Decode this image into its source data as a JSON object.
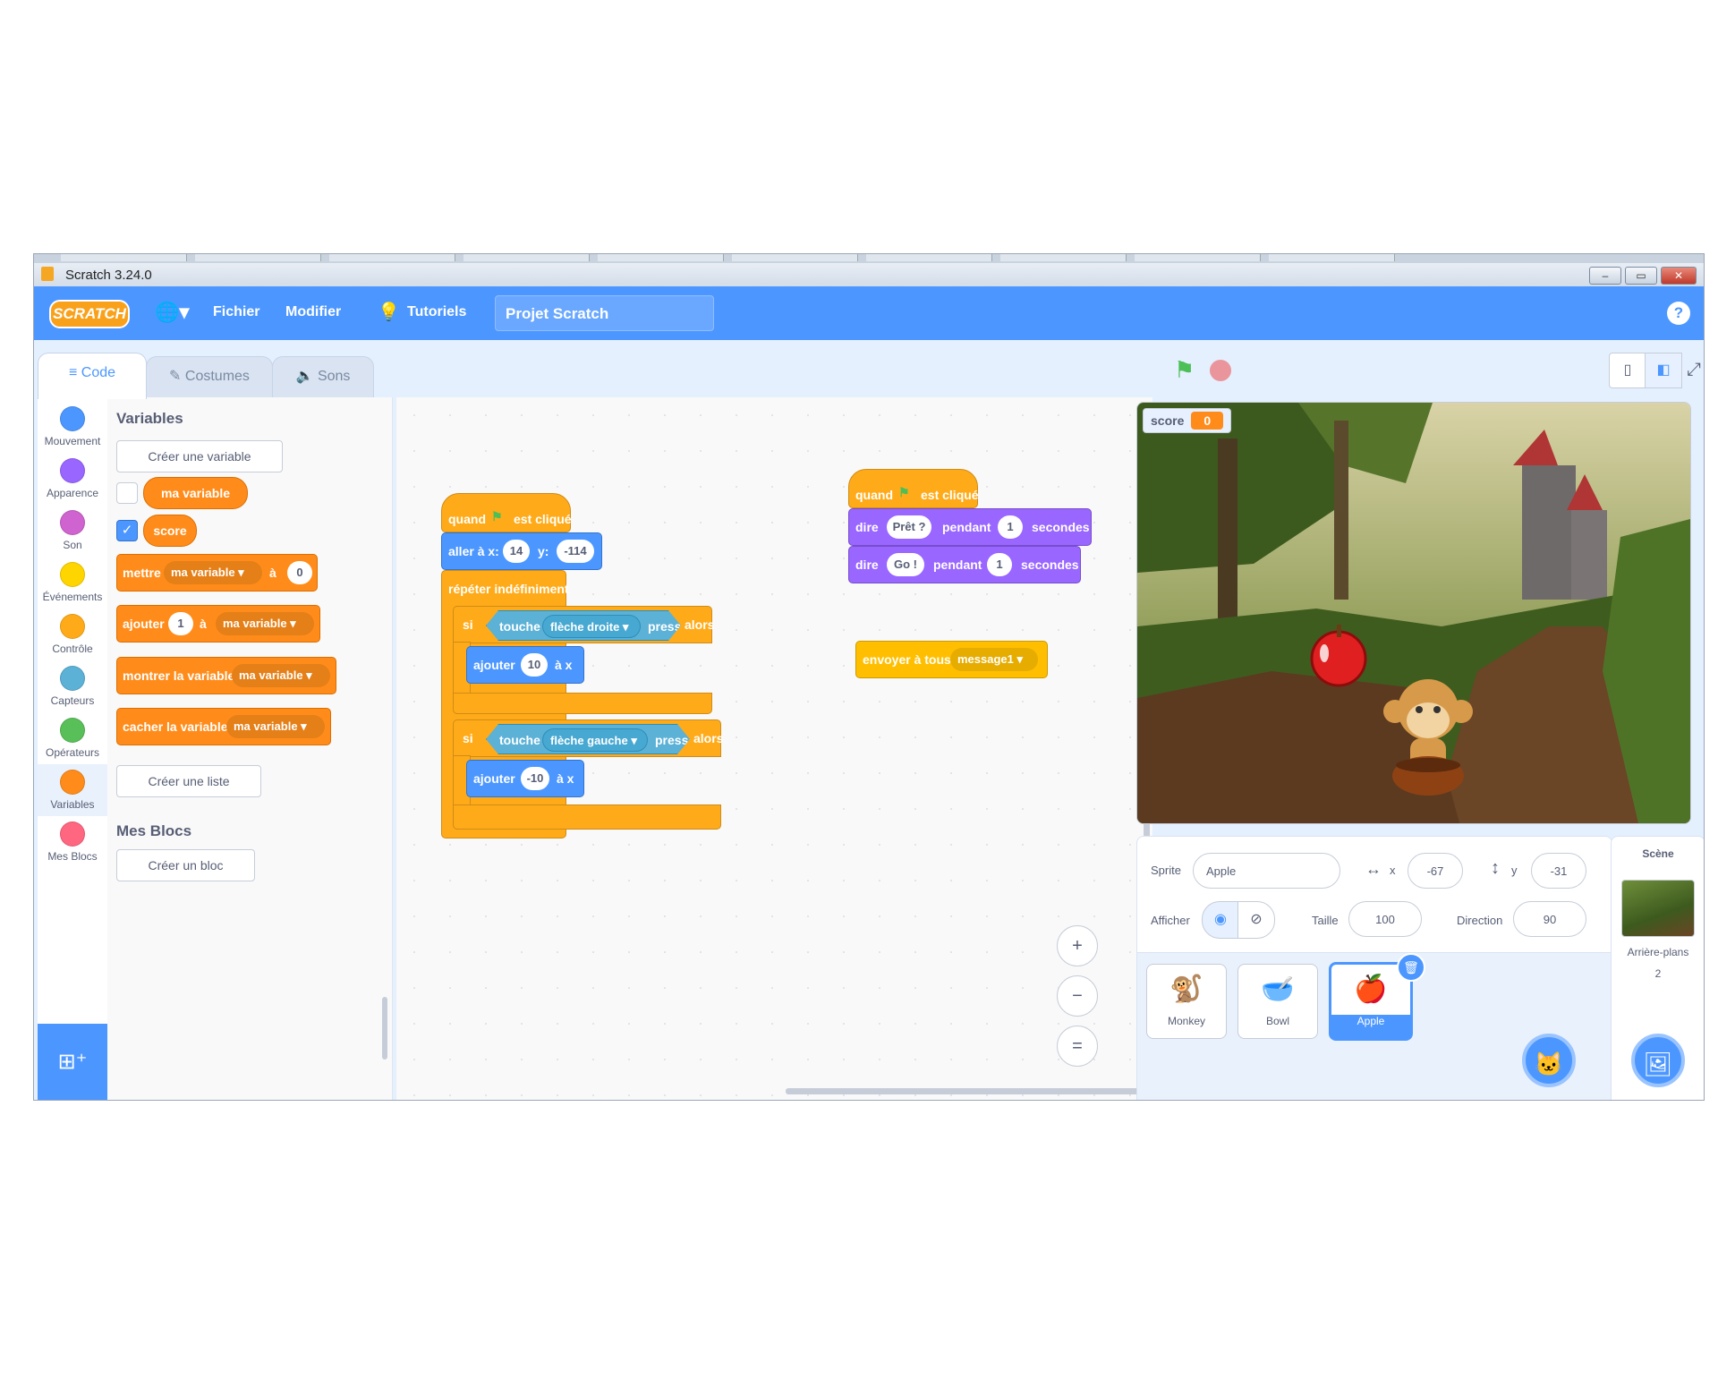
{
  "window": {
    "title": "Scratch 3.24.0",
    "min": "–",
    "max": "▭",
    "close": "✕"
  },
  "menubar": {
    "logo": "SCRATCH",
    "language_icon": "globe-icon",
    "file": "Fichier",
    "edit": "Modifier",
    "tutorials": "Tutoriels",
    "project_name": "Projet Scratch",
    "help": "?"
  },
  "tabs": [
    {
      "label": "Code",
      "icon": "code-icon"
    },
    {
      "label": "Costumes",
      "icon": "brush-icon"
    },
    {
      "label": "Sons",
      "icon": "speaker-icon"
    }
  ],
  "categories": [
    {
      "label": "Mouvement",
      "color": "#4c97ff"
    },
    {
      "label": "Apparence",
      "color": "#9966ff"
    },
    {
      "label": "Son",
      "color": "#cf63cf"
    },
    {
      "label": "Événements",
      "color": "#ffd500"
    },
    {
      "label": "Contrôle",
      "color": "#ffab19"
    },
    {
      "label": "Capteurs",
      "color": "#5cb1d6"
    },
    {
      "label": "Opérateurs",
      "color": "#59c059"
    },
    {
      "label": "Variables",
      "color": "#ff8c1a"
    },
    {
      "label": "Mes Blocs",
      "color": "#ff6680"
    }
  ],
  "flyout": {
    "variables_heading": "Variables",
    "create_variable": "Créer une variable",
    "var1": "ma variable",
    "var2": "score",
    "set_block": {
      "label": "mettre",
      "var": "ma variable",
      "to": "à",
      "value": "0"
    },
    "change_block": {
      "label": "ajouter",
      "value": "1",
      "to": "à",
      "var": "ma variable"
    },
    "show_block": {
      "label": "montrer la variable",
      "var": "ma variable"
    },
    "hide_block": {
      "label": "cacher la variable",
      "var": "ma variable"
    },
    "create_list": "Créer une liste",
    "myblocks_heading": "Mes Blocs",
    "create_block": "Créer un bloc"
  },
  "script1": {
    "hat_when": "quand",
    "hat_clicked": "est cliqué",
    "goto": "aller à x:",
    "x": "14",
    "y_label": "y:",
    "y": "-114",
    "forever": "répéter indéfiniment",
    "if": "si",
    "touch": "touche",
    "key_right": "flèche droite",
    "pressed": "pressée ?",
    "then": "alors",
    "change_x": "ajouter",
    "val_right": "10",
    "to_x": "à x",
    "key_left": "flèche gauche",
    "val_left": "-10",
    "loop_arrow": "↻"
  },
  "script2": {
    "hat_when": "quand",
    "hat_clicked": "est cliqué",
    "say": "dire",
    "msg1": "Prêt ?",
    "for": "pendant",
    "sec1": "1",
    "seconds": "secondes",
    "msg2": "Go !",
    "sec2": "1"
  },
  "script3": {
    "broadcast": "envoyer à tous",
    "message": "message1"
  },
  "zoom": {
    "in": "+",
    "out": "−",
    "reset": "="
  },
  "stage": {
    "monitor_label": "score",
    "monitor_value": "0"
  },
  "sprite_info": {
    "sprite_label": "Sprite",
    "sprite_name": "Apple",
    "x_label": "x",
    "x": "-67",
    "y_label": "y",
    "y": "-31",
    "show_label": "Afficher",
    "size_label": "Taille",
    "size": "100",
    "direction_label": "Direction",
    "direction": "90"
  },
  "sprites": [
    {
      "name": "Monkey",
      "icon": "monkey-icon"
    },
    {
      "name": "Bowl",
      "icon": "bowl-icon"
    },
    {
      "name": "Apple",
      "icon": "apple-icon"
    }
  ],
  "stage_panel": {
    "title": "Scène",
    "backdrops_label": "Arrière-plans",
    "backdrops_count": "2"
  }
}
